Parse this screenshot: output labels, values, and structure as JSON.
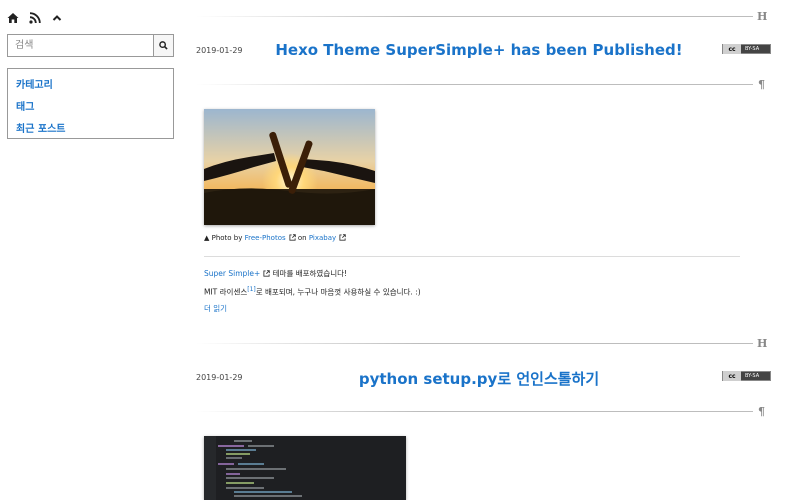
{
  "sidebar": {
    "icons": [
      "home-icon",
      "rss-icon",
      "chevron-up-icon"
    ],
    "search": {
      "placeholder": "검색",
      "value": ""
    },
    "nav": [
      {
        "label": "카테고리"
      },
      {
        "label": "태그"
      },
      {
        "label": "최근 포스트"
      }
    ]
  },
  "posts": [
    {
      "date": "2019-01-29",
      "title": "Hexo Theme SuperSimple+ has been Published!",
      "license": "BY-SA",
      "caption": {
        "prefix": "▲ Photo by",
        "author": "Free-Photos",
        "on": "on",
        "site": "Pixabay"
      },
      "line1_link": "Super Simple+",
      "line1_rest": "테마를 배포하였습니다!",
      "line2_a": "MIT 라이센스",
      "line2_sup": "[1]",
      "line2_b": "로 배포되며, 누구나 마음껏 사용하실 수 있습니다. :)",
      "read_more": "더 읽기"
    },
    {
      "date": "2019-01-29",
      "title_code": "python setup.py",
      "title_rest": "로 언인스톨하기",
      "license": "BY-SA"
    }
  ],
  "marks": {
    "heading": "H",
    "paragraph": "¶"
  },
  "colors": {
    "link": "#1a73c9",
    "divider": "#bdbdbd"
  }
}
